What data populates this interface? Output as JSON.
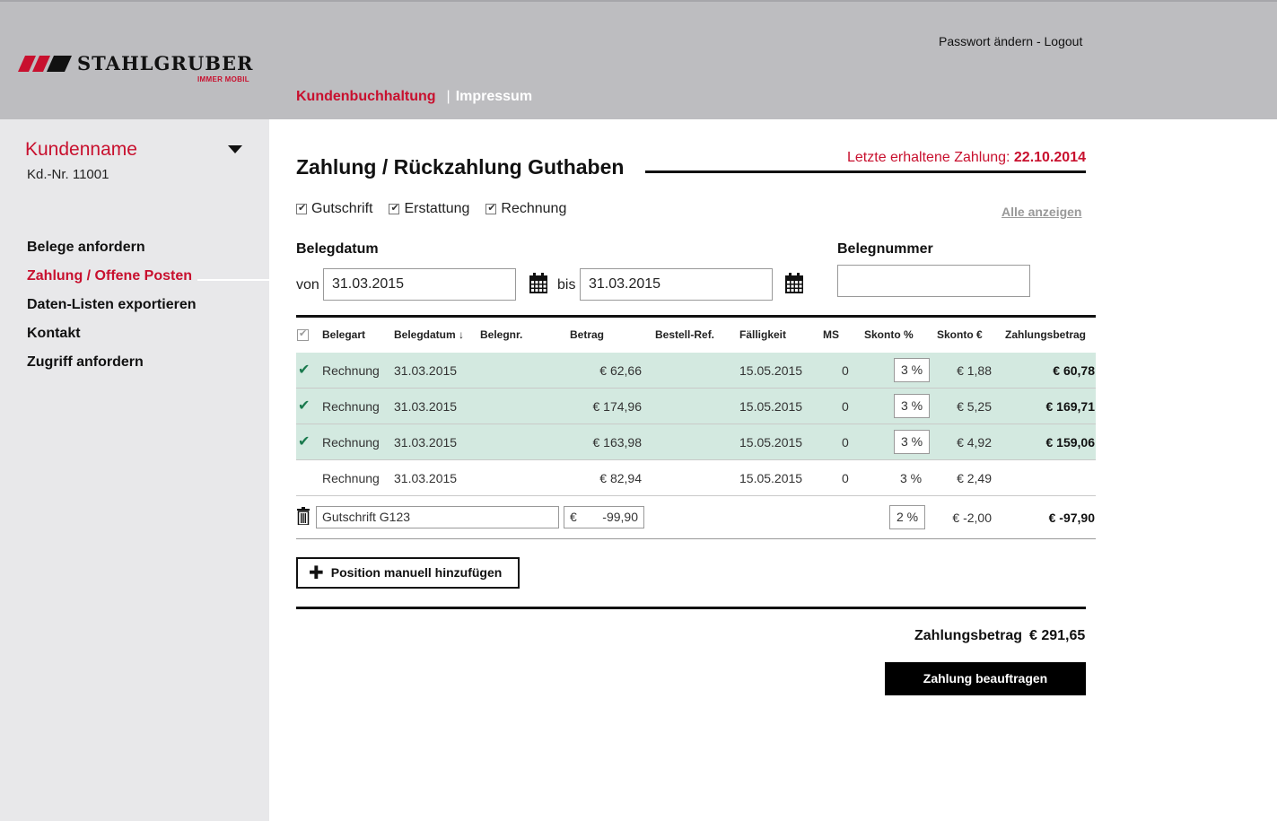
{
  "header": {
    "logo_text": "STAHLGRUBER",
    "logo_sub": "IMMER MOBIL",
    "change_password": "Passwort ändern",
    "separator": " - ",
    "logout": "Logout",
    "nav": {
      "active": "Kundenbuchhaltung",
      "sep": "|",
      "impressum": "Impressum"
    }
  },
  "sidebar": {
    "customer_name": "Kundenname",
    "customer_nr": "Kd.-Nr. 11001",
    "items": [
      {
        "label": "Belege anfordern"
      },
      {
        "label": "Zahlung / Offene Posten"
      },
      {
        "label": "Daten-Listen exportieren"
      },
      {
        "label": "Kontakt"
      },
      {
        "label": "Zugriff anfordern"
      }
    ]
  },
  "main": {
    "title": "Zahlung / Rückzahlung Guthaben",
    "last_payment_label": "Letzte erhaltene Zahlung: ",
    "last_payment_date": "22.10.2014",
    "filters": [
      "Gutschrift",
      "Erstattung",
      "Rechnung"
    ],
    "show_all": "Alle anzeigen",
    "belegdatum_label": "Belegdatum",
    "von": "von",
    "bis": "bis",
    "date_from": "31.03.2015",
    "date_to": "31.03.2015",
    "belegnummer_label": "Belegnummer",
    "belegnummer_value": ""
  },
  "table": {
    "headers": [
      "Belegart",
      "Belegdatum ↓",
      "Belegnr.",
      "Betrag",
      "Bestell-Ref.",
      "Fälligkeit",
      "MS",
      "Skonto %",
      "Skonto €",
      "Zahlungsbetrag"
    ],
    "rows": [
      {
        "belegart": "Rechnung",
        "datum": "31.03.2015",
        "betrag": "€ 62,66",
        "faellig": "15.05.2015",
        "ms": "0",
        "skonto_pct": "3 %",
        "skonto_eur": "€ 1,88",
        "zahlbetrag": "€ 60,78"
      },
      {
        "belegart": "Rechnung",
        "datum": "31.03.2015",
        "betrag": "€ 174,96",
        "faellig": "15.05.2015",
        "ms": "0",
        "skonto_pct": "3 %",
        "skonto_eur": "€ 5,25",
        "zahlbetrag": "€ 169,71"
      },
      {
        "belegart": "Rechnung",
        "datum": "31.03.2015",
        "betrag": "€ 163,98",
        "faellig": "15.05.2015",
        "ms": "0",
        "skonto_pct": "3 %",
        "skonto_eur": "€ 4,92",
        "zahlbetrag": "€ 159,06"
      },
      {
        "belegart": "Rechnung",
        "datum": "31.03.2015",
        "betrag": "€ 82,94",
        "faellig": "15.05.2015",
        "ms": "0",
        "skonto_pct": "3 %",
        "skonto_eur": "€ 2,49",
        "zahlbetrag": ""
      }
    ],
    "manual": {
      "name": "Gutschrift G123",
      "currency": "€",
      "amount": "-99,90",
      "skonto_pct": "2 %",
      "skonto_eur": "€ -2,00",
      "zahlbetrag": "€ -97,90"
    }
  },
  "actions": {
    "add_position": "Position manuell hinzufügen",
    "sum_label": "Zahlungsbetrag",
    "sum_value": "€ 291,65",
    "pay_button": "Zahlung beauftragen"
  },
  "colors": {
    "brand_red": "#c8102e",
    "selected_row": "#d3e9e0",
    "check_green": "#1a7a4e",
    "header_gray": "#bdbdc0",
    "sidebar_gray": "#e8e8ea"
  }
}
